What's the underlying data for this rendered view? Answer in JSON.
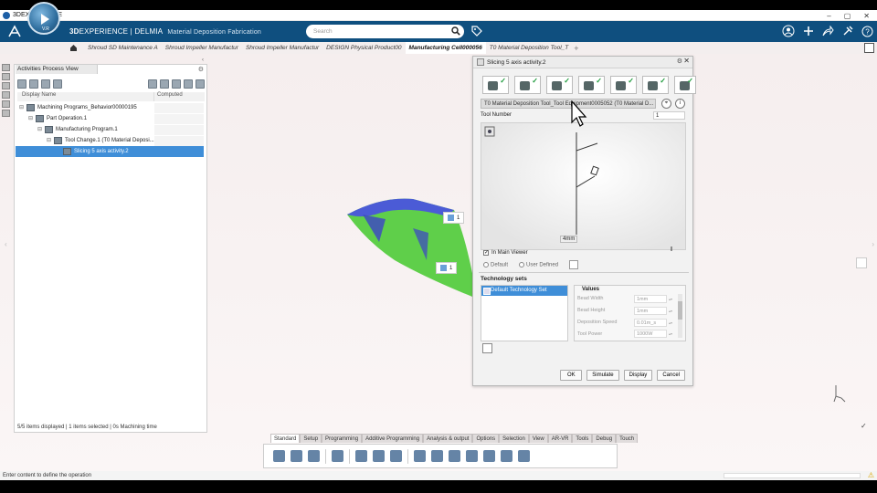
{
  "os": {
    "app_name": "3DEXPERIENCE"
  },
  "header": {
    "brand_3d": "3D",
    "brand_experience": "EXPERIENCE | DELMIA",
    "app_title": "Material Deposition Fabrication",
    "search_placeholder": "Search",
    "compass_version": "V.R"
  },
  "tabs": [
    {
      "label": "Shroud SD Maintenance A"
    },
    {
      "label": "Shroud Impeller Manufactur"
    },
    {
      "label": "Shroud Impeller Manufactur"
    },
    {
      "label": "DESIGN Physical Product00"
    },
    {
      "label": "Manufacturing Cell000056"
    },
    {
      "label": "T0 Material Deposition Tool_T"
    }
  ],
  "tab_plus": "+",
  "panel": {
    "tab_label": "Activities Process View",
    "col_display_name": "Display Name",
    "col_computed": "Computed",
    "tree": [
      {
        "label": "Machining Programs_Behavior00000195",
        "indent": 0,
        "toggle": "⊟"
      },
      {
        "label": "Part Operation.1",
        "indent": 1,
        "toggle": "⊟"
      },
      {
        "label": "Manufacturing Program.1",
        "indent": 2,
        "toggle": "⊟"
      },
      {
        "label": "Tool Change.1 (T0 Material Deposi...",
        "indent": 3,
        "toggle": "⊟"
      },
      {
        "label": "Slicing 5 axis activity.2",
        "indent": 4,
        "toggle": ""
      }
    ],
    "status": "5/5 items displayed | 1 items selected | 0s Machining time"
  },
  "tags_3d": {
    "tag1": "1",
    "tag2": "1"
  },
  "dialog": {
    "title": "Slicing 5 axis activity.2",
    "tool_field": "T0 Material Deposition Tool_Tool Equipment0005052 (T0 Material D...",
    "tool_number_label": "Tool Number",
    "tool_number_value": "1",
    "mm_label": "4mm",
    "in_main_viewer": "In Main Viewer",
    "radio_default": "Default",
    "radio_user_defined": "User Defined",
    "tech_sets_title": "Technology sets",
    "tech_item": "Default Technology Set",
    "values_title": "Values",
    "values": [
      {
        "label": "Bead Width",
        "value": "1mm"
      },
      {
        "label": "Bead Height",
        "value": "1mm"
      },
      {
        "label": "Deposition Speed",
        "value": "0.01m_s"
      },
      {
        "label": "Tool Power",
        "value": "1000W"
      }
    ],
    "buttons": {
      "ok": "OK",
      "simulate": "Simulate",
      "display": "Display",
      "cancel": "Cancel"
    }
  },
  "command_tabs": [
    {
      "label": "Standard",
      "active": true
    },
    {
      "label": "Setup"
    },
    {
      "label": "Programming"
    },
    {
      "label": "Additive Programming"
    },
    {
      "label": "Analysis & output"
    },
    {
      "label": "Options"
    },
    {
      "label": "Selection"
    },
    {
      "label": "View"
    },
    {
      "label": "AR-VR"
    },
    {
      "label": "Tools"
    },
    {
      "label": "Debug"
    },
    {
      "label": "Touch"
    }
  ],
  "status_bar": {
    "text": "Enter content to define the operation"
  },
  "colors": {
    "header_bg": "#0f4f7f",
    "selection": "#3f8ed8",
    "part_green": "#5fcf4a",
    "part_blue": "#4b5bd6"
  }
}
